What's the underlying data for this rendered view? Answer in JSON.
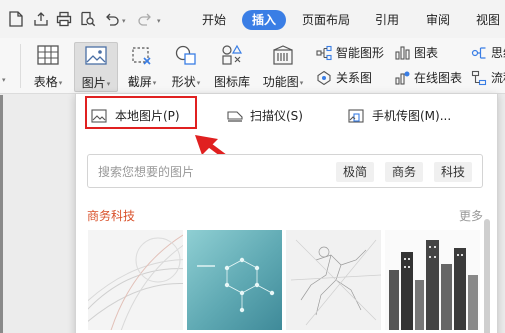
{
  "tabs": [
    {
      "label": "开始",
      "active": false
    },
    {
      "label": "插入",
      "active": true
    },
    {
      "label": "页面布局",
      "active": false
    },
    {
      "label": "引用",
      "active": false
    },
    {
      "label": "审阅",
      "active": false
    },
    {
      "label": "视图",
      "active": false
    }
  ],
  "ribbon": {
    "table_label": "表格",
    "picture_label": "图片",
    "screenshot_label": "截屏",
    "shape_label": "形状",
    "iconlib_label": "图标库",
    "funcchart_label": "功能图",
    "smartart_label": "智能图形",
    "chart_label": "图表",
    "mindmap_label": "思维",
    "relation_label": "关系图",
    "onlinechart_label": "在线图表",
    "flowchart_label": "流程"
  },
  "dropdown": {
    "local_picture": "本地图片(P)",
    "scanner": "扫描仪(S)",
    "phone_transfer": "手机传图(M)...",
    "search_placeholder": "搜索您想要的图片",
    "chips": [
      "极简",
      "商务",
      "科技"
    ],
    "section_title": "商务科技",
    "more": "更多"
  },
  "colors": {
    "accent": "#3a7ee5",
    "highlight_red": "#e02020",
    "section_title": "#d9512b"
  }
}
